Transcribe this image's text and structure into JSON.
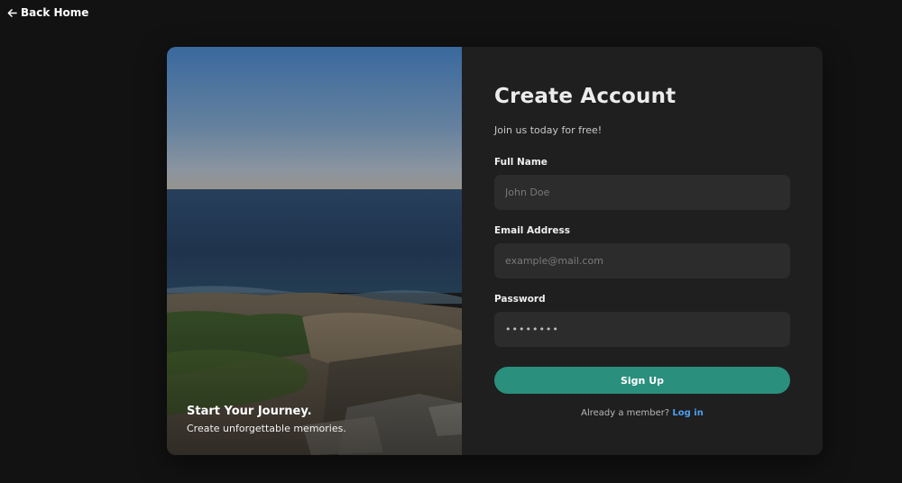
{
  "nav": {
    "back_label": "Back Home",
    "back_icon": "arrow-left-icon"
  },
  "hero": {
    "title": "Start Your Journey.",
    "subtitle": "Create unforgettable memories."
  },
  "form": {
    "title": "Create Account",
    "subtitle": "Join us today for free!",
    "fields": [
      {
        "label": "Full Name",
        "placeholder": "John Doe",
        "value": ""
      },
      {
        "label": "Email Address",
        "placeholder": "example@mail.com",
        "value": ""
      },
      {
        "label": "Password",
        "placeholder": "",
        "value": "••••••••"
      }
    ],
    "submit_label": "Sign Up",
    "login_prompt": "Already a member?",
    "login_link": "Log in"
  },
  "colors": {
    "background": "#121212",
    "card": "#1f1f1f",
    "input": "#2c2c2c",
    "accent": "#2a8f7d",
    "link": "#4b9ff0"
  }
}
